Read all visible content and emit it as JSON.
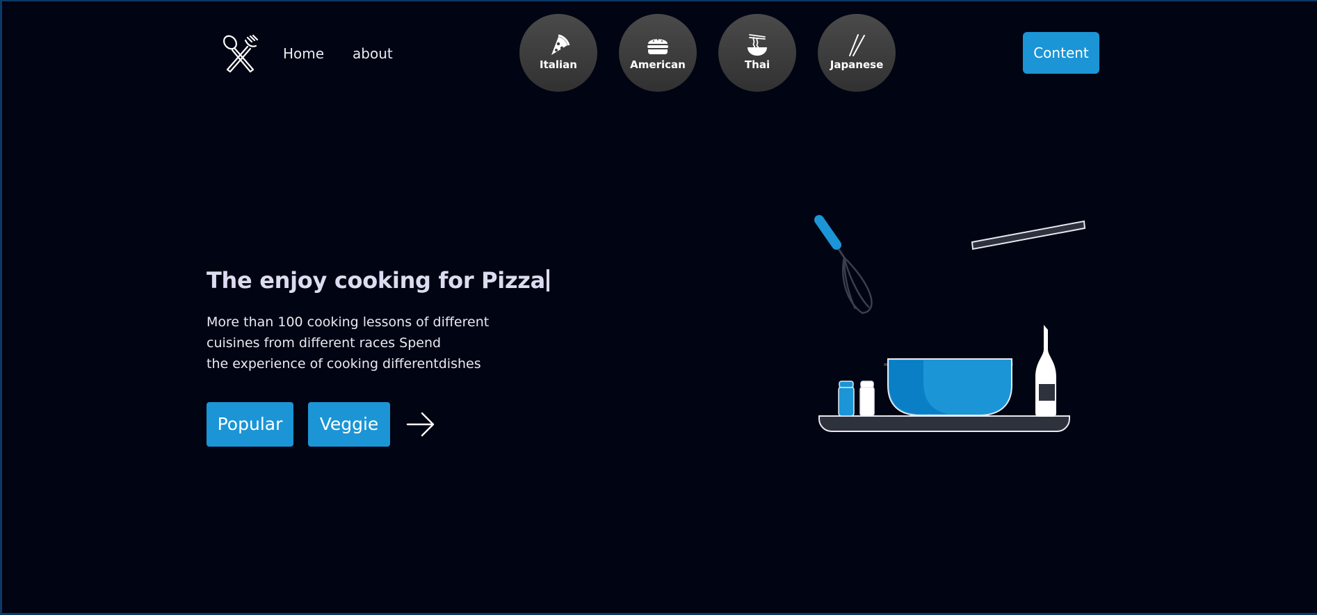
{
  "nav": {
    "links": [
      {
        "label": "Home"
      },
      {
        "label": "about"
      }
    ]
  },
  "cuisines": [
    {
      "label": "Italian",
      "icon": "pizza-slice-icon"
    },
    {
      "label": "American",
      "icon": "burger-icon"
    },
    {
      "label": "Thai",
      "icon": "noodle-bowl-icon"
    },
    {
      "label": "Japanese",
      "icon": "chopsticks-icon"
    }
  ],
  "header": {
    "content_button": "Content",
    "logo_icon": "spoon-fork-icon"
  },
  "hero": {
    "title": "The enjoy cooking for Pizza",
    "description": [
      "More than 100 cooking lessons of different",
      "cuisines from different races Spend",
      "the experience of cooking differentdishes"
    ],
    "buttons": [
      {
        "label": "Popular"
      },
      {
        "label": "Veggie"
      }
    ],
    "arrow_icon": "arrow-right-icon",
    "illustration_icon": "kitchen-tools-icon"
  },
  "colors": {
    "background": "#010412",
    "accent": "#1b95d6",
    "circle": "#3e3e3e",
    "text": "#e8e9f2"
  }
}
